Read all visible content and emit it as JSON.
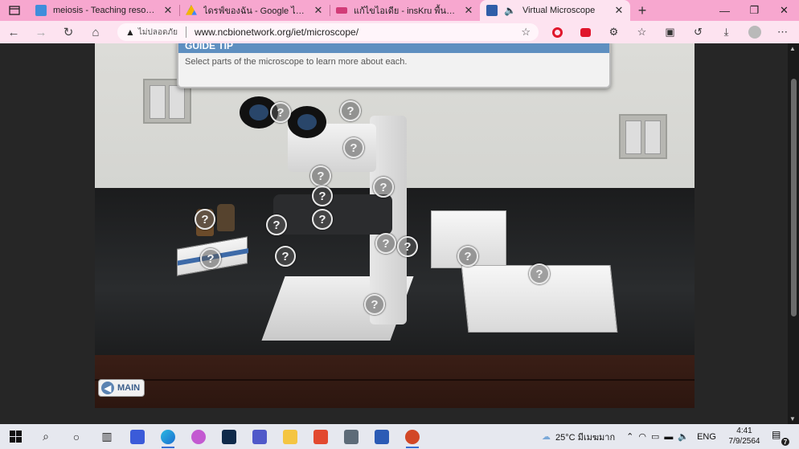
{
  "browser": {
    "tabs": [
      {
        "title": "meiosis - Teaching resources",
        "favicon_color": "#3f8ddb",
        "active": false
      },
      {
        "title": "ไดรฟ์ของฉัน - Google ไดรฟ์",
        "favicon_color": "#f4b400",
        "active": false
      },
      {
        "title": "แก้ไขไอเดีย - insKru พื้นที่แบ่งปันไอเดีย",
        "favicon_color": "#d23c78",
        "active": false
      },
      {
        "title": "Virtual Microscope",
        "favicon_color": "#2f5da8",
        "active": true
      }
    ],
    "newtab_label": "+",
    "window_controls": {
      "minimize": "—",
      "maximize": "❐",
      "close": "✕"
    },
    "nav": {
      "back": "←",
      "forward": "→",
      "refresh": "↻",
      "home": "⌂"
    },
    "address": {
      "warning_label": "ไม่ปลอดภัย",
      "url": "www.ncbionetwork.org/iet/microscope/"
    }
  },
  "page": {
    "guide_tip": {
      "heading": "GUIDE TIP",
      "text": "Select parts of the microscope to learn more about each."
    },
    "hotspot_label": "?",
    "main_button": {
      "label": "MAIN",
      "icon": "arrow-left-icon"
    }
  },
  "taskbar": {
    "weather": "25°C มีเมฆมาก",
    "language": "ENG",
    "time": "4:41",
    "date": "7/9/2564",
    "notifications": "7"
  }
}
